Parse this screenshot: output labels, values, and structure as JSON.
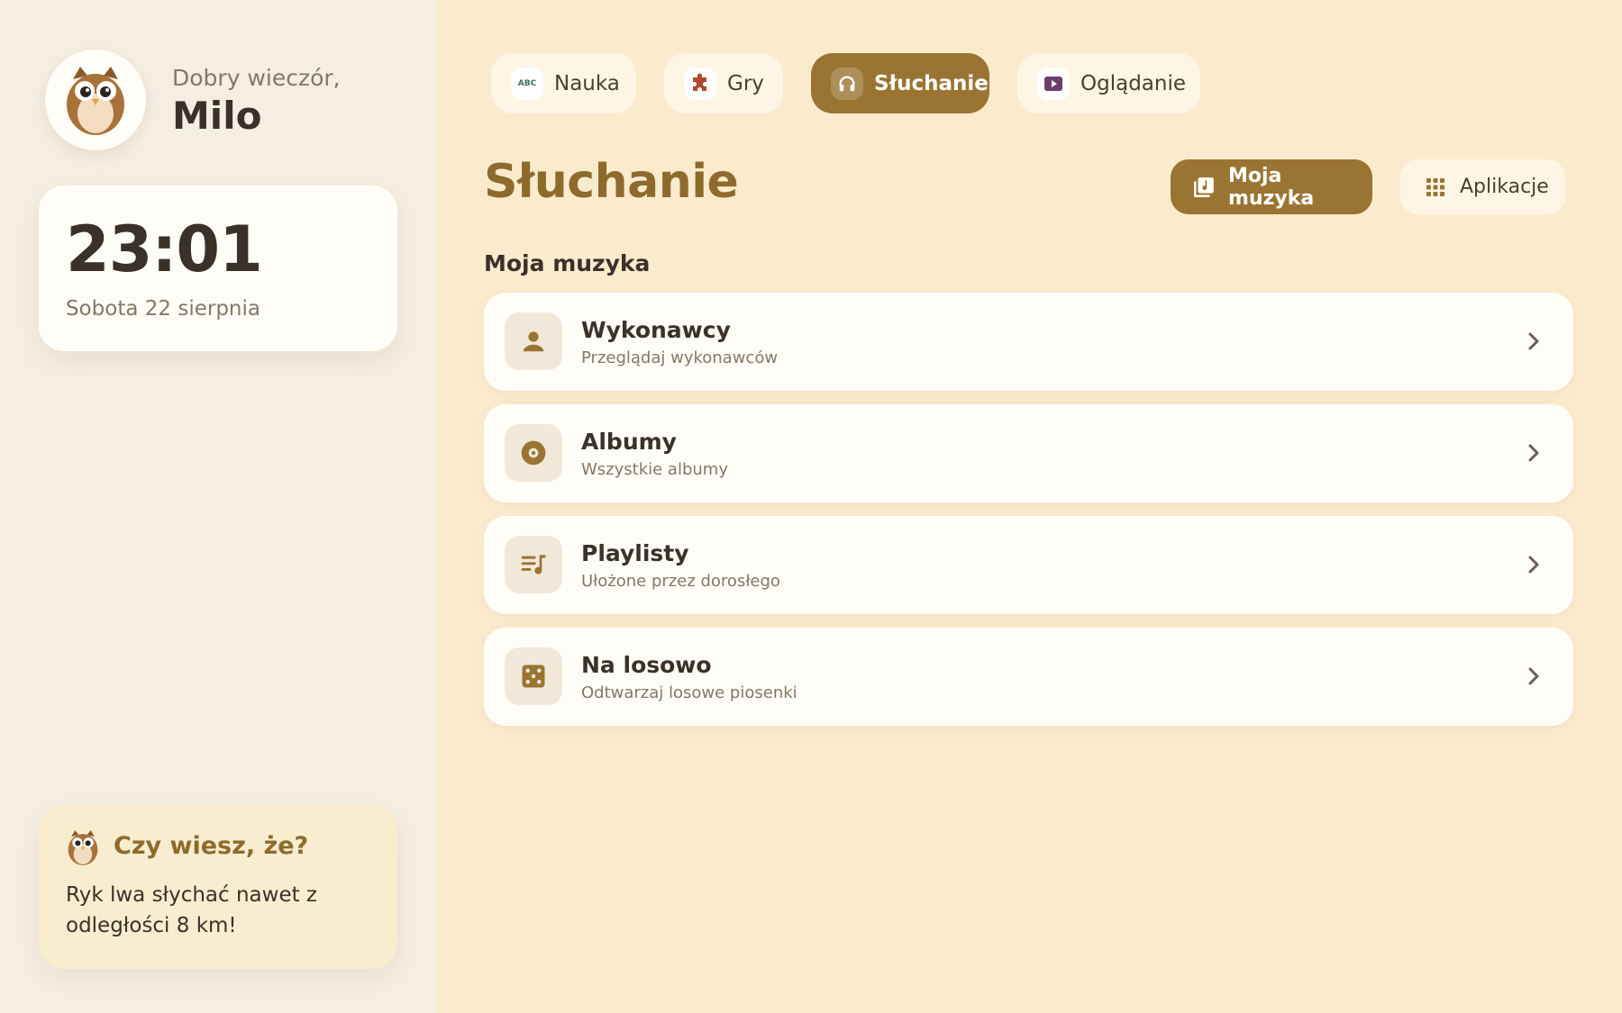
{
  "sidebar": {
    "greeting": "Dobry wieczór,",
    "user_name": "Milo",
    "clock": {
      "time": "23:01",
      "date": "Sobota 22 sierpnia"
    },
    "fact": {
      "title": "Czy wiesz, że?",
      "text": "Ryk lwa słychać nawet z odległości 8 km!"
    }
  },
  "tabs": [
    {
      "label": "Nauka",
      "icon": "abc-icon",
      "active": false
    },
    {
      "label": "Gry",
      "icon": "puzzle-icon",
      "active": false
    },
    {
      "label": "Słuchanie",
      "icon": "headphones-icon",
      "active": true
    },
    {
      "label": "Oglądanie",
      "icon": "play-icon",
      "active": false
    }
  ],
  "tab_icon_texts": {
    "abc": "ABC"
  },
  "header": {
    "title": "Słuchanie",
    "primary_button": "Moja muzyka",
    "secondary_button": "Aplikacje"
  },
  "section_title": "Moja muzyka",
  "items": [
    {
      "title": "Wykonawcy",
      "subtitle": "Przeglądaj wykonawców",
      "icon": "person-icon"
    },
    {
      "title": "Albumy",
      "subtitle": "Wszystkie albumy",
      "icon": "disc-icon"
    },
    {
      "title": "Playlisty",
      "subtitle": "Ułożone przez dorosłego",
      "icon": "playlist-icon"
    },
    {
      "title": "Na losowo",
      "subtitle": "Odtwarzaj losowe piosenki",
      "icon": "dice-icon"
    }
  ],
  "colors": {
    "accent": "#9A7432",
    "title": "#8E6A2D",
    "background": "#FBEBCD",
    "sidebar": "#F5EEE3",
    "card": "#FFFDF8"
  }
}
